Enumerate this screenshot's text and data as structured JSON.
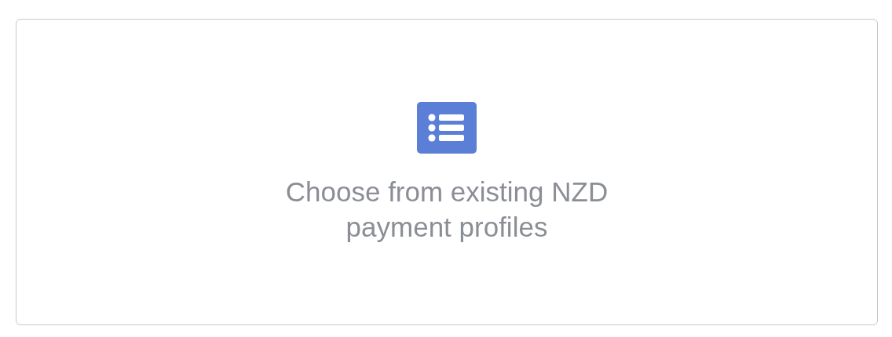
{
  "option_card": {
    "label": "Choose from existing NZD payment profiles"
  }
}
